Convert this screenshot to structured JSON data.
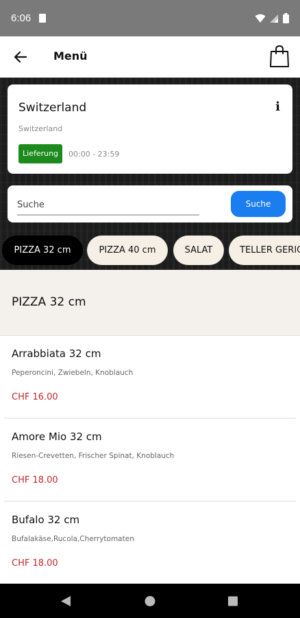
{
  "status_bar": {
    "time": "6:06"
  },
  "app_bar": {
    "title": "Menü"
  },
  "store": {
    "name": "Switzerland",
    "subtitle": "Switzerland",
    "delivery_badge": "Lieferung",
    "hours": "00:00 - 23:59",
    "info_icon": "info-icon"
  },
  "search": {
    "placeholder": "Suche",
    "button_label": "Suche"
  },
  "tabs": [
    {
      "label": "PIZZA 32 cm",
      "active": true
    },
    {
      "label": "PIZZA 40 cm",
      "active": false
    },
    {
      "label": "SALAT",
      "active": false
    },
    {
      "label": "TELLER GERICHTE",
      "active": false
    }
  ],
  "section": {
    "title": "PIZZA 32 cm"
  },
  "items": [
    {
      "name": "Arrabbiata 32 cm",
      "description": "Peperoncini, Zwiebeln, Knoblauch",
      "price": "CHF 16.00"
    },
    {
      "name": "Amore Mio 32 cm",
      "description": "Riesen-Crevetten, Frischer Spinat, Knoblauch",
      "price": "CHF 18.00"
    },
    {
      "name": "Bufalo 32 cm",
      "description": "Bufalakäse,Rucola,Cherrytomaten",
      "price": "CHF 18.00"
    }
  ],
  "colors": {
    "accent_blue": "#1a7df0",
    "badge_green": "#1c8a1c",
    "price_red": "#c0282b",
    "section_bg": "#f4f0eb"
  }
}
